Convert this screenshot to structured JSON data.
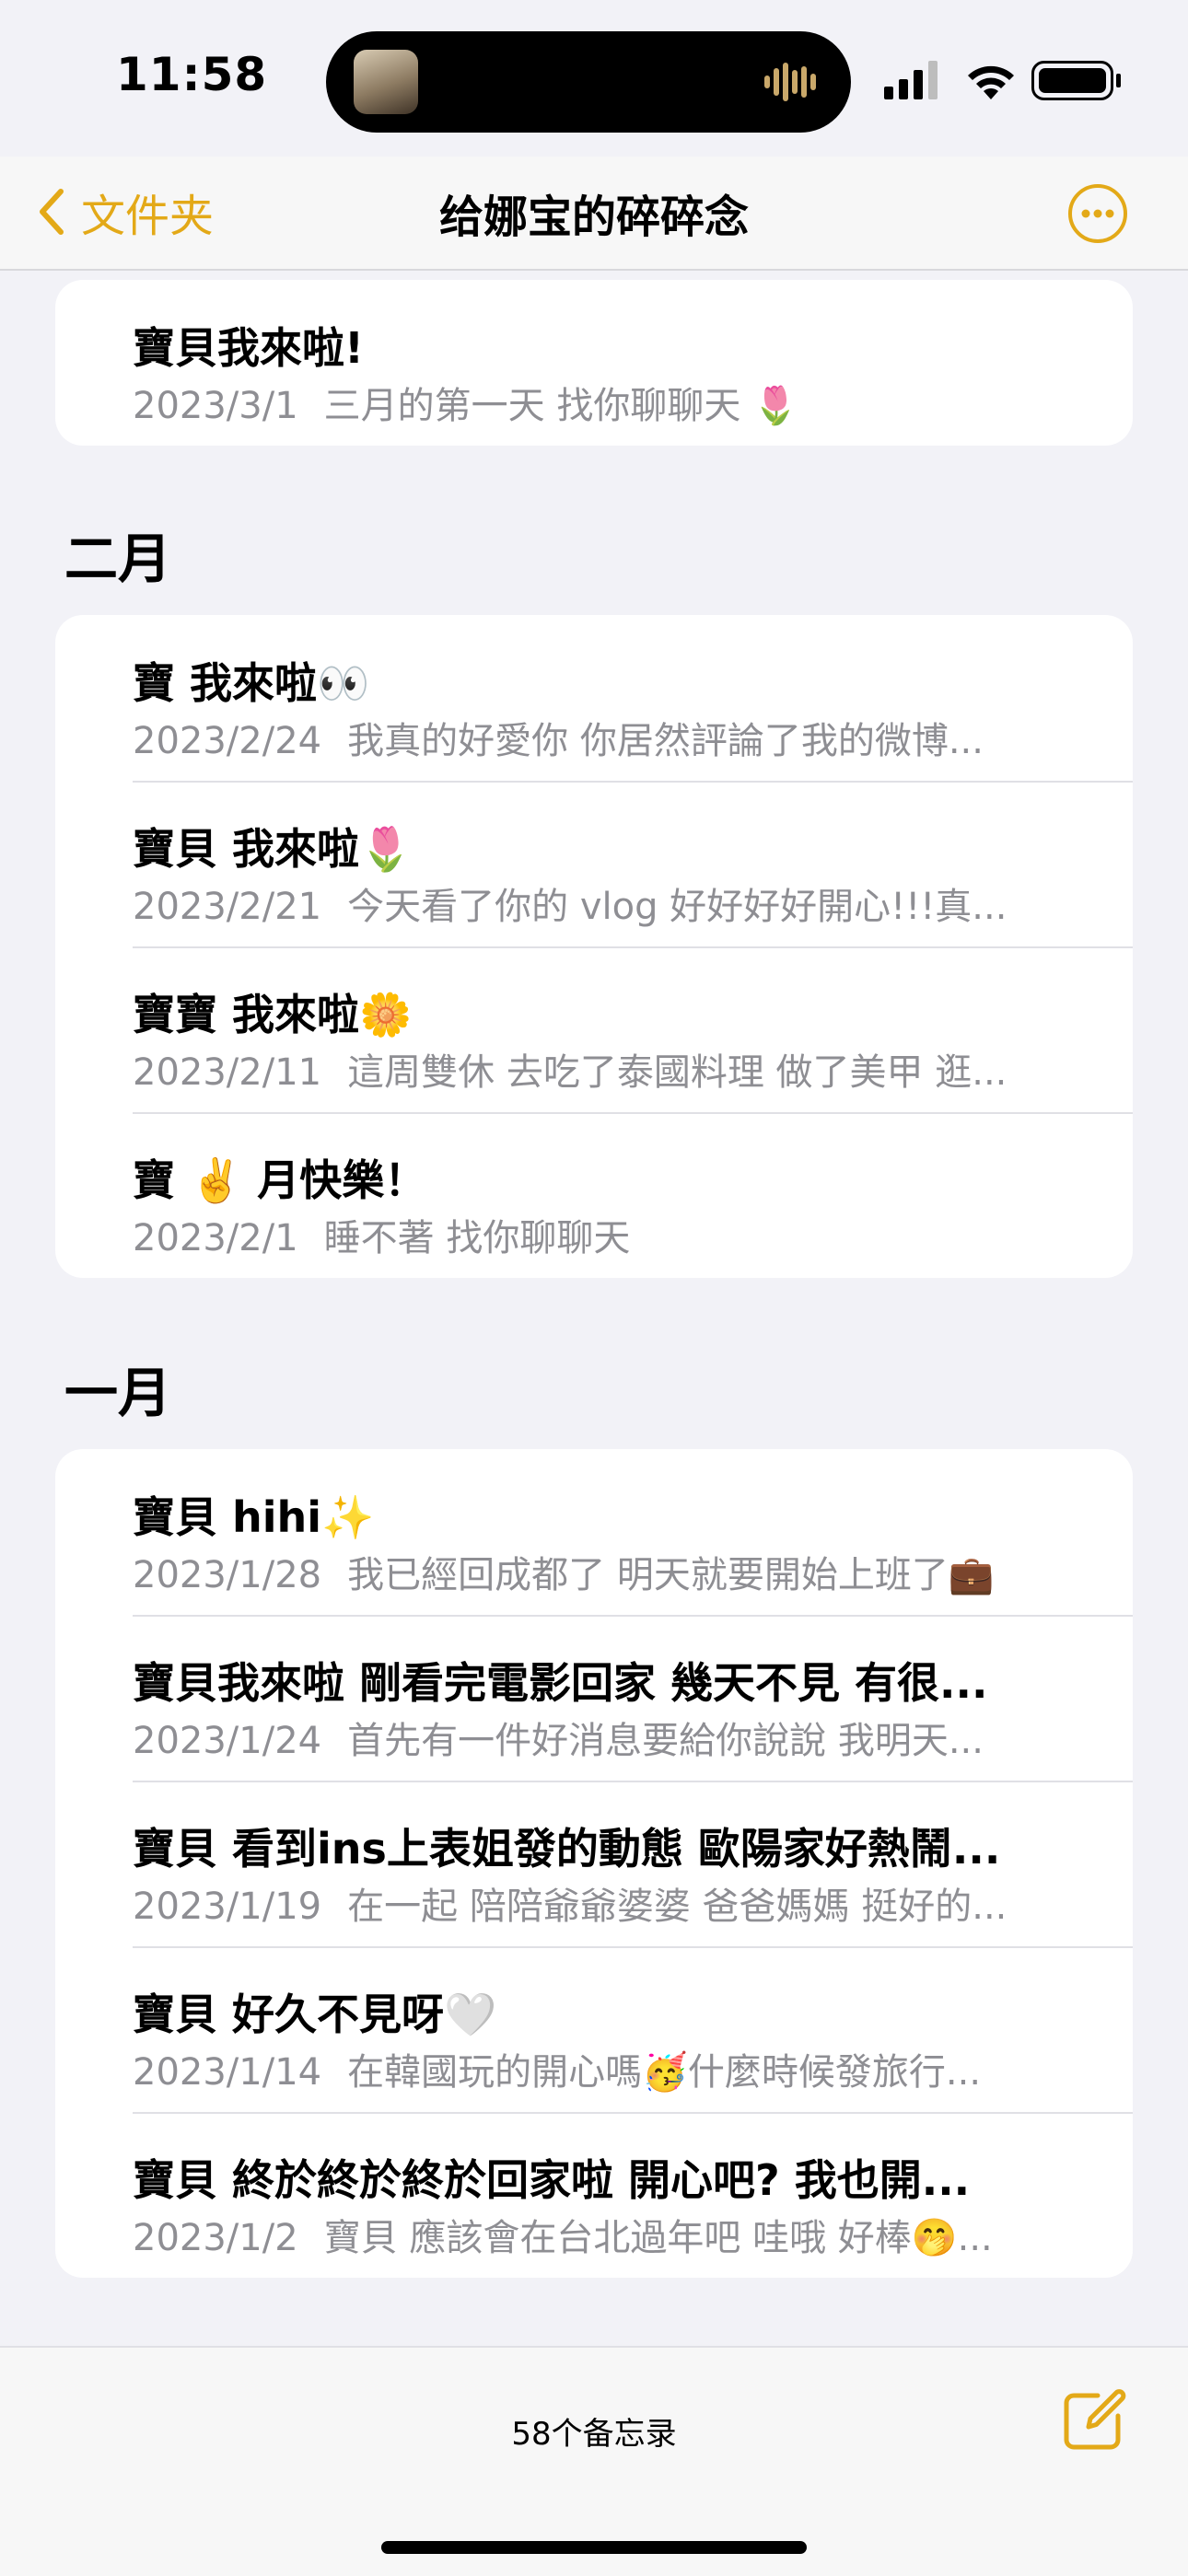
{
  "status_bar": {
    "time": "11:58"
  },
  "nav": {
    "back_label": "文件夹",
    "title": "给娜宝的碎碎念",
    "accent_color": "#e3a918"
  },
  "sections": [
    {
      "header": "",
      "notes": [
        {
          "title": "寶貝我來啦!",
          "date": "2023/3/1",
          "preview": "三月的第一天 找你聊聊天 🌷"
        }
      ]
    },
    {
      "header": "二月",
      "notes": [
        {
          "title": "寶 我來啦👀",
          "date": "2023/2/24",
          "preview": "我真的好愛你 你居然評論了我的微博..."
        },
        {
          "title": "寶貝 我來啦🌷",
          "date": "2023/2/21",
          "preview": "今天看了你的 vlog 好好好好開心!!!真..."
        },
        {
          "title": "寶寶 我來啦🌼",
          "date": "2023/2/11",
          "preview": "這周雙休 去吃了泰國料理 做了美甲 逛..."
        },
        {
          "title": "寶 ✌️ 月快樂！",
          "date": "2023/2/1",
          "preview": "睡不著 找你聊聊天"
        }
      ]
    },
    {
      "header": "一月",
      "notes": [
        {
          "title": "寶貝 hihi✨",
          "date": "2023/1/28",
          "preview": "我已經回成都了 明天就要開始上班了💼"
        },
        {
          "title": "寶貝我來啦 剛看完電影回家 幾天不見 有很...",
          "date": "2023/1/24",
          "preview": "首先有一件好消息要給你說說 我明天..."
        },
        {
          "title": "寶貝 看到ins上表姐發的動態 歐陽家好熱鬧...",
          "date": "2023/1/19",
          "preview": "在一起 陪陪爺爺婆婆 爸爸媽媽 挺好的..."
        },
        {
          "title": "寶貝 好久不見呀🤍",
          "date": "2023/1/14",
          "preview": "在韓國玩的開心嗎🥳什麼時候發旅行..."
        },
        {
          "title": "寶貝 終於終於終於回家啦 開心吧? 我也開...",
          "date": "2023/1/2",
          "preview": "寶貝 應該會在台北過年吧 哇哦 好棒🤭..."
        }
      ]
    }
  ],
  "toolbar": {
    "note_count": "58个备忘录"
  }
}
